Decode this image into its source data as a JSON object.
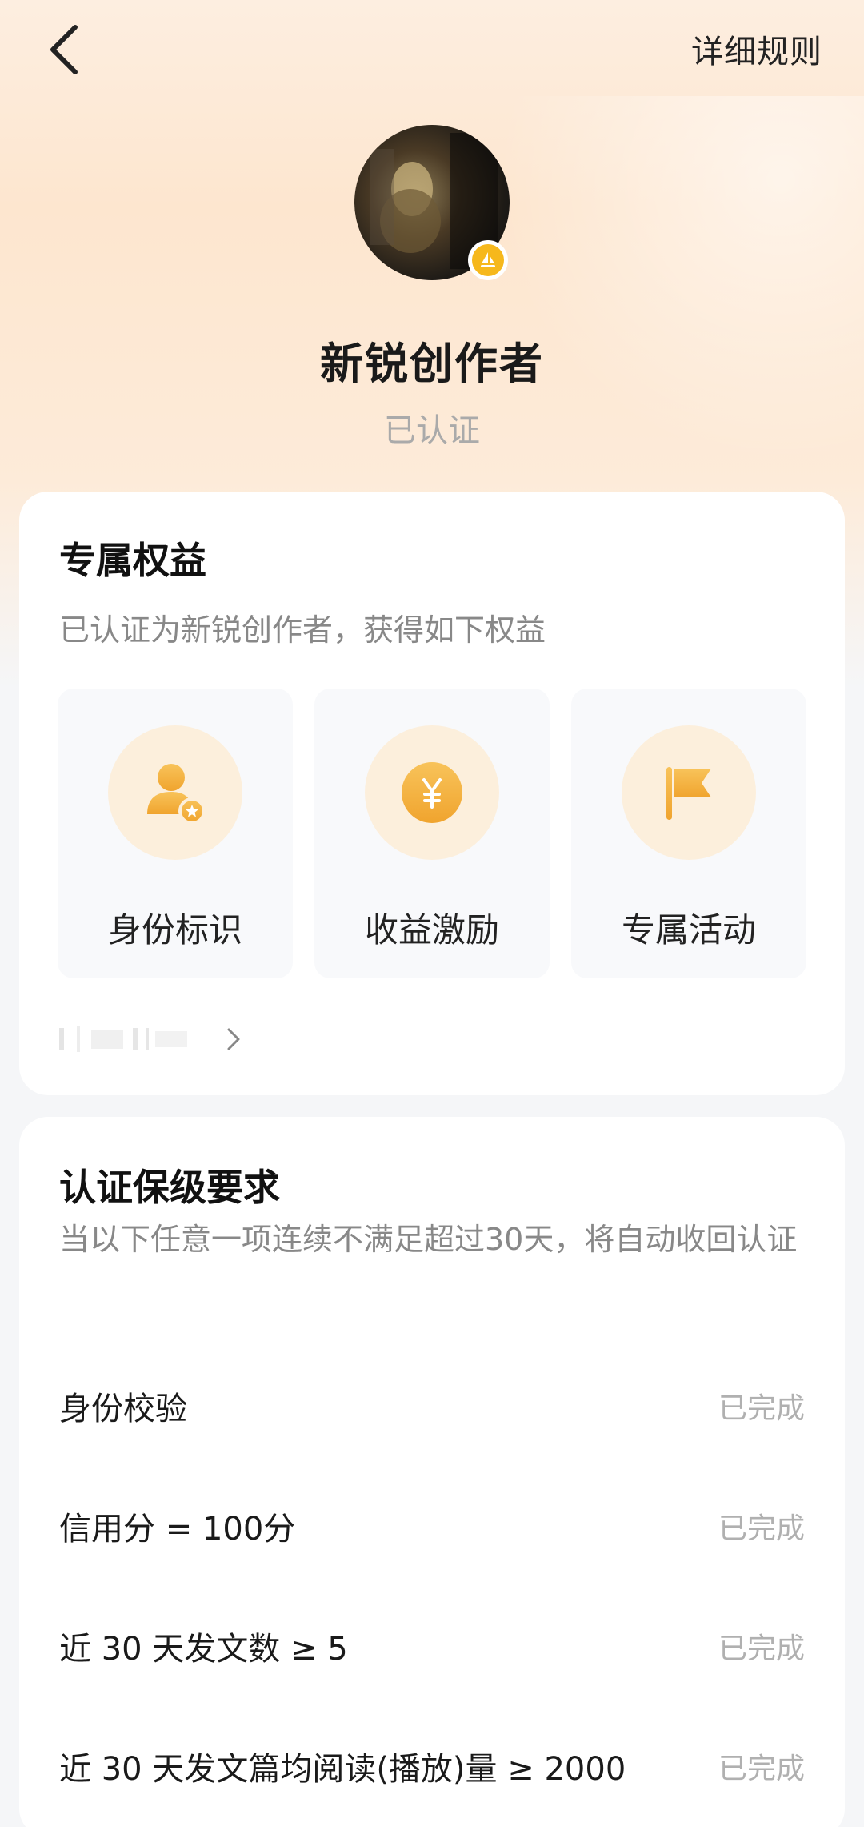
{
  "header": {
    "back_icon": "chevron-left-icon",
    "rules_label": "详细规则"
  },
  "profile": {
    "level_name": "新锐创作者",
    "status": "已认证",
    "badge_icon": "sailboat-badge-icon",
    "badge_color": "#f6b81c"
  },
  "benefits_card": {
    "title": "专属权益",
    "description": "已认证为新锐创作者，获得如下权益",
    "items": [
      {
        "label": "身份标识",
        "icon": "user-star-icon"
      },
      {
        "label": "收益激励",
        "icon": "yuan-coin-icon"
      },
      {
        "label": "专属活动",
        "icon": "flag-icon"
      }
    ],
    "more_icon": "chevron-right-icon"
  },
  "requirements_card": {
    "title": "认证保级要求",
    "description": "当以下任意一项连续不满足超过30天，将自动收回认证",
    "items": [
      {
        "label": "身份校验",
        "status": "已完成"
      },
      {
        "label": "信用分 = 100分",
        "status": "已完成"
      },
      {
        "label": "近 30 天发文数 ≥ 5",
        "status": "已完成"
      },
      {
        "label": "近 30 天发文篇均阅读(播放)量 ≥ 2000",
        "status": "已完成"
      }
    ]
  },
  "colors": {
    "accent": "#f5b040",
    "icon_bg": "#fcefdc",
    "muted_text": "#888888"
  }
}
